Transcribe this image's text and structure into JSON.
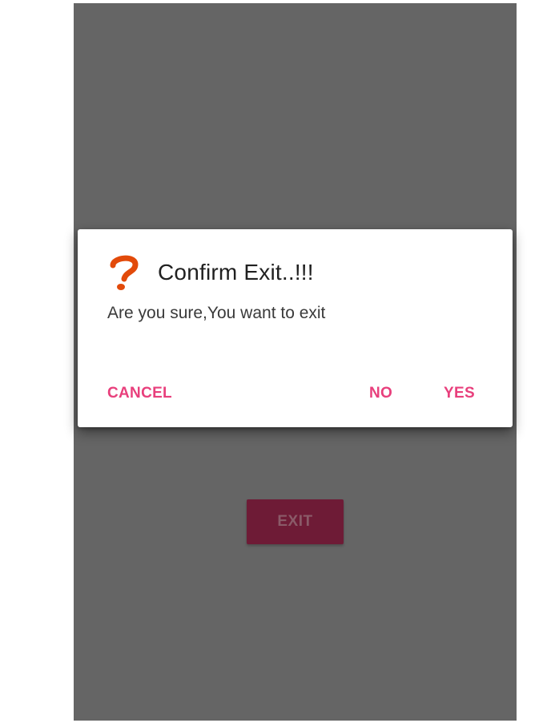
{
  "background_button": {
    "label": "EXIT"
  },
  "dialog": {
    "icon": "question-mark-icon",
    "icon_color": "#e24a0a",
    "title": "Confirm Exit..!!!",
    "message": "Are you sure,You want to exit",
    "actions": {
      "cancel": "CANCEL",
      "no": "NO",
      "yes": "YES"
    },
    "accent_color": "#e83f7c"
  },
  "colors": {
    "scrim": "#656565",
    "exit_button_bg": "#6e1b36"
  }
}
